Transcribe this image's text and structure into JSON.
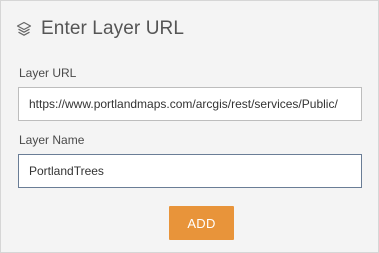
{
  "header": {
    "icon": "layers-icon",
    "title": "Enter Layer URL"
  },
  "form": {
    "url_label": "Layer URL",
    "url_value": "https://www.portlandmaps.com/arcgis/rest/services/Public/",
    "name_label": "Layer Name",
    "name_value": "PortlandTrees"
  },
  "actions": {
    "add_label": "ADD"
  },
  "colors": {
    "accent": "#e8943a",
    "panel_bg": "#f4f4f4"
  }
}
